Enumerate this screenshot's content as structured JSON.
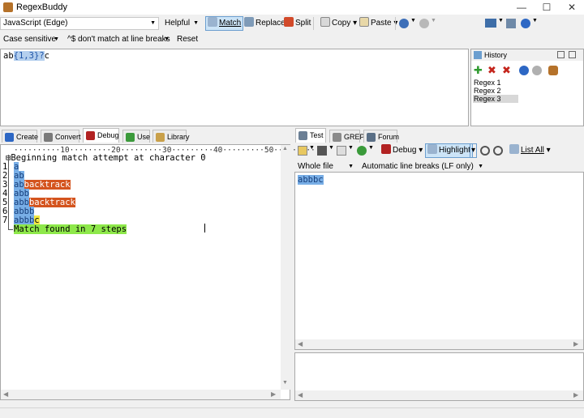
{
  "window": {
    "title": "RegexBuddy",
    "minimize": "—",
    "maximize": "☐",
    "close": "✕"
  },
  "toolbar1": {
    "flavor": "JavaScript (Edge)",
    "helpful": "Helpful",
    "match": "Match",
    "replace": "Replace",
    "split": "Split",
    "copy": "Copy",
    "paste": "Paste"
  },
  "toolbar2": {
    "case": "Case sensitive",
    "lines": "^$ don't match at line breaks",
    "reset": "Reset"
  },
  "regex": {
    "prefix": "ab",
    "quantifier": "{1,3}?",
    "suffix": "c"
  },
  "history": {
    "title": "History",
    "items": [
      "Regex 1",
      "Regex 2",
      "Regex 3"
    ],
    "selected": "Regex 3"
  },
  "left_tabs": [
    "Create",
    "Convert",
    "Debug",
    "Use",
    "Library"
  ],
  "left_active_tab": "Debug",
  "debug": {
    "ruler": "··········10·········20·········30·········40·········50·········",
    "header": "⊟Beginning match attempt at character 0",
    "steps": [
      {
        "num": "1",
        "match": "a",
        "backtrack": "",
        "current": ""
      },
      {
        "num": "2",
        "match": "ab",
        "backtrack": "",
        "current": ""
      },
      {
        "num": "3",
        "match": "ab",
        "backtrack": "backtrack",
        "current": ""
      },
      {
        "num": "4",
        "match": "abb",
        "backtrack": "",
        "current": ""
      },
      {
        "num": "5",
        "match": "abb",
        "backtrack": "backtrack",
        "current": ""
      },
      {
        "num": "6",
        "match": "abbb",
        "backtrack": "",
        "current": ""
      },
      {
        "num": "7",
        "match": "abbb",
        "backtrack": "",
        "current": "c"
      }
    ],
    "result": "Match found in 7 steps"
  },
  "right_tabs": [
    "Test",
    "GREP",
    "Forum"
  ],
  "right_active_tab": "Test",
  "test_toolbar": {
    "debug": "Debug",
    "highlight": "Highlight",
    "list_all": "List All",
    "scope": "Whole file",
    "line_breaks": "Automatic line breaks (LF only)"
  },
  "test": {
    "subject": "abbbc"
  },
  "colors": {
    "match": "#78aee6",
    "backtrack": "#d4541e",
    "current": "#f4e942",
    "success": "#8ee84a",
    "selection": "#cce4f7"
  }
}
